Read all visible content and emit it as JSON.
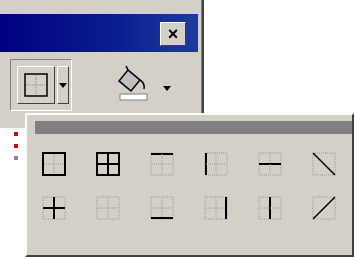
{
  "window": {
    "title": "",
    "close_label": "×"
  },
  "toolbar": {
    "borders_icon": "borders-grid-icon",
    "fill_color_icon": "paint-bucket-icon",
    "fill_color_swatch": "#ffffff"
  },
  "palette": {
    "title": "",
    "rows": [
      [
        "outside-borders",
        "all-borders",
        "top-border",
        "left-border",
        "inside-horizontal-border",
        "diagonal-down-border"
      ],
      [
        "inside-borders",
        "no-border",
        "bottom-border",
        "right-border",
        "inside-vertical-border",
        "diagonal-up-border"
      ]
    ]
  },
  "colors": {
    "titlebar": "#000080",
    "face": "#d4d0c8"
  }
}
